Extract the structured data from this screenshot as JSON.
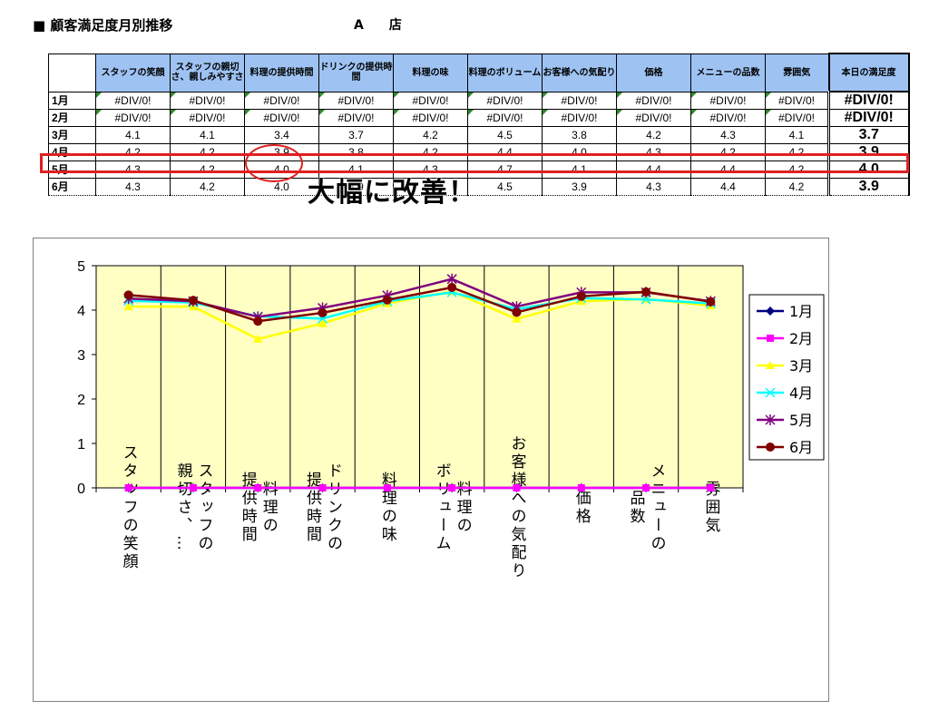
{
  "title": "■ 顧客満足度月別推移",
  "store_label": "A　　店",
  "table": {
    "columns": [
      "スタッフの笑顔",
      "スタッフの親切さ、親しみやすさ",
      "料理の提供時間",
      "ドリンクの提供時間",
      "料理の味",
      "料理のボリューム",
      "お客様への気配り",
      "価格",
      "メニューの品数",
      "雰囲気"
    ],
    "score_header": "本日の満足度",
    "rows": [
      {
        "month": "1月",
        "values": [
          "#DIV/0!",
          "#DIV/0!",
          "#DIV/0!",
          "#DIV/0!",
          "#DIV/0!",
          "#DIV/0!",
          "#DIV/0!",
          "#DIV/0!",
          "#DIV/0!",
          "#DIV/0!"
        ],
        "score": "#DIV/0!"
      },
      {
        "month": "2月",
        "values": [
          "#DIV/0!",
          "#DIV/0!",
          "#DIV/0!",
          "#DIV/0!",
          "#DIV/0!",
          "#DIV/0!",
          "#DIV/0!",
          "#DIV/0!",
          "#DIV/0!",
          "#DIV/0!"
        ],
        "score": "#DIV/0!"
      },
      {
        "month": "3月",
        "values": [
          "4.1",
          "4.1",
          "3.4",
          "3.7",
          "4.2",
          "4.5",
          "3.8",
          "4.2",
          "4.3",
          "4.1"
        ],
        "score": "3.7"
      },
      {
        "month": "4月",
        "values": [
          "4.2",
          "4.2",
          "3.9",
          "3.8",
          "4.2",
          "4.4",
          "4.0",
          "4.3",
          "4.2",
          "4.2"
        ],
        "score": "3.9"
      },
      {
        "month": "5月",
        "values": [
          "4.3",
          "4.2",
          "4.0",
          "4.1",
          "4.3",
          "4.7",
          "4.1",
          "4.4",
          "4.4",
          "4.2"
        ],
        "score": "4.0"
      },
      {
        "month": "6月",
        "values": [
          "4.3",
          "4.2",
          "4.0",
          "3.9",
          "4.2",
          "4.5",
          "3.9",
          "4.3",
          "4.4",
          "4.2"
        ],
        "score": "3.9"
      }
    ]
  },
  "annotation": "大幅に改善！",
  "colors": {
    "header_bg": "#9ec3f3",
    "highlight": "#e02020",
    "plot_bg": "#ffffc4",
    "marker_triangle": "#2e8b2e"
  },
  "chart_data": {
    "type": "line",
    "categories": [
      "スタッフの笑顔",
      "スタッフの親切さ、…",
      "料理の提供時間",
      "ドリンクの提供時間",
      "料理の味",
      "料理のボリューム",
      "お客様への気配り",
      "価格",
      "メニューの品数",
      "雰囲気"
    ],
    "category_lines": [
      [
        "スタッフの笑顔"
      ],
      [
        "スタッフの",
        "親切さ、…"
      ],
      [
        "料理の",
        "提供時間"
      ],
      [
        "ドリンクの",
        "提供時間"
      ],
      [
        "料理の味"
      ],
      [
        "料理の",
        "ボリューム"
      ],
      [
        "お客様への気配り"
      ],
      [
        "価格"
      ],
      [
        "メニューの",
        "品数"
      ],
      [
        "雰囲気"
      ]
    ],
    "ylim": [
      0,
      5
    ],
    "yticks": [
      "0",
      "1",
      "2",
      "3",
      "4",
      "5"
    ],
    "grid": "vertical category lines",
    "legend_position": "right",
    "series": [
      {
        "name": "1月",
        "color": "#000080",
        "marker": "diamond",
        "values": [
          0,
          0,
          0,
          0,
          0,
          0,
          0,
          0,
          0,
          0
        ]
      },
      {
        "name": "2月",
        "color": "#ff00ff",
        "marker": "square",
        "values": [
          0,
          0,
          0,
          0,
          0,
          0,
          0,
          0,
          0,
          0
        ]
      },
      {
        "name": "3月",
        "color": "#ffff00",
        "marker": "triangle",
        "values": [
          4.08,
          4.08,
          3.35,
          3.7,
          4.15,
          4.42,
          3.8,
          4.2,
          4.25,
          4.1
        ]
      },
      {
        "name": "4月",
        "color": "#00ffff",
        "marker": "x",
        "values": [
          4.21,
          4.17,
          3.86,
          3.81,
          4.2,
          4.4,
          4.02,
          4.27,
          4.24,
          4.15
        ]
      },
      {
        "name": "5月",
        "color": "#800080",
        "marker": "star",
        "values": [
          4.26,
          4.2,
          3.85,
          4.05,
          4.33,
          4.7,
          4.08,
          4.4,
          4.4,
          4.2
        ]
      },
      {
        "name": "6月",
        "color": "#800000",
        "marker": "circle",
        "values": [
          4.34,
          4.22,
          3.75,
          3.94,
          4.23,
          4.51,
          3.95,
          4.31,
          4.41,
          4.19
        ]
      }
    ]
  }
}
